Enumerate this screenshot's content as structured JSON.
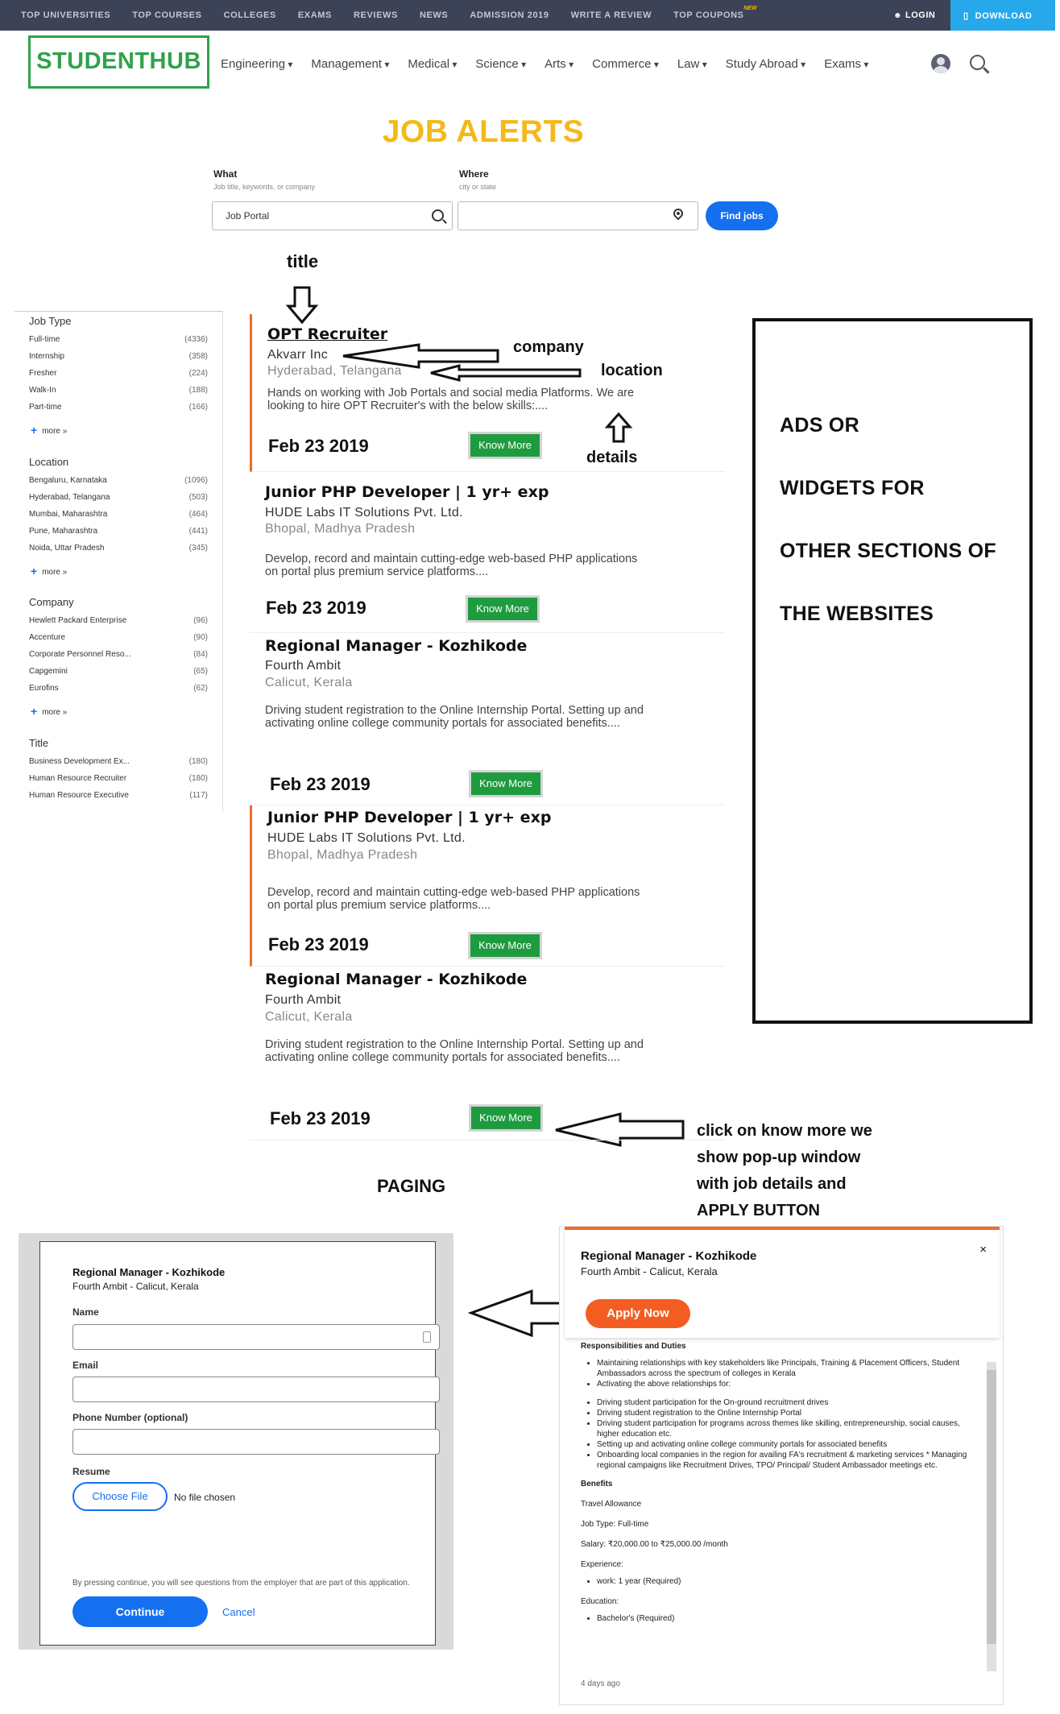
{
  "topbar": {
    "nav": [
      "TOP UNIVERSITIES",
      "TOP COURSES",
      "COLLEGES",
      "EXAMS",
      "REVIEWS",
      "NEWS",
      "ADMISSION 2019",
      "WRITE A REVIEW",
      "TOP COUPONS"
    ],
    "new_badge": "NEW",
    "login": "LOGIN",
    "download": "DOWNLOAD"
  },
  "header": {
    "logo": "STUDENTHUB",
    "nav": [
      "Engineering",
      "Management",
      "Medical",
      "Science",
      "Arts",
      "Commerce",
      "Law",
      "Study Abroad",
      "Exams"
    ]
  },
  "search": {
    "page_title": "JOB ALERTS",
    "what_label": "What",
    "what_sub": "Job title, keywords, or company",
    "what_value": "Job Portal",
    "where_label": "Where",
    "where_sub": "city or state",
    "where_value": "",
    "find_button": "Find jobs"
  },
  "annotations": {
    "title": "title",
    "company": "company",
    "location": "location",
    "details": "details",
    "paging": "PAGING",
    "popup_note": [
      "click on know more we",
      "show pop-up window",
      "with job details and",
      "APPLY BUTTON"
    ]
  },
  "sidebar": {
    "job_type": {
      "heading": "Job Type",
      "items": [
        {
          "label": "Full-time",
          "count": "(4336)"
        },
        {
          "label": "Internship",
          "count": "(358)"
        },
        {
          "label": "Fresher",
          "count": "(224)"
        },
        {
          "label": "Walk-In",
          "count": "(188)"
        },
        {
          "label": "Part-time",
          "count": "(166)"
        }
      ],
      "more": "more »"
    },
    "location": {
      "heading": "Location",
      "items": [
        {
          "label": "Bengaluru, Karnataka",
          "count": "(1096)"
        },
        {
          "label": "Hyderabad, Telangana",
          "count": "(503)"
        },
        {
          "label": "Mumbai, Maharashtra",
          "count": "(464)"
        },
        {
          "label": "Pune, Maharashtra",
          "count": "(441)"
        },
        {
          "label": "Noida, Uttar Pradesh",
          "count": "(345)"
        }
      ],
      "more": "more »"
    },
    "company": {
      "heading": "Company",
      "items": [
        {
          "label": "Hewlett Packard Enterprise",
          "count": "(96)"
        },
        {
          "label": "Accenture",
          "count": "(90)"
        },
        {
          "label": "Corporate Personnel Reso...",
          "count": "(84)"
        },
        {
          "label": "Capgemini",
          "count": "(65)"
        },
        {
          "label": "Eurofins",
          "count": "(62)"
        }
      ],
      "more": "more »"
    },
    "title": {
      "heading": "Title",
      "items": [
        {
          "label": "Business Development Ex...",
          "count": "(180)"
        },
        {
          "label": "Human Resource Recruiter",
          "count": "(180)"
        },
        {
          "label": "Human Resource Executive",
          "count": "(117)"
        }
      ]
    }
  },
  "jobs": [
    {
      "title": "OPT Recruiter",
      "company": "Akvarr Inc",
      "location": "Hyderabad, Telangana",
      "desc": "Hands on working with Job Portals and social media Platforms. We are looking to hire OPT Recruiter's with the below skills:....",
      "date": "Feb 23 2019",
      "button": "Know More"
    },
    {
      "title": "Junior PHP Developer | 1 yr+ exp",
      "company": "HUDE Labs IT Solutions Pvt. Ltd.",
      "location": "Bhopal, Madhya Pradesh",
      "desc": "Develop, record and maintain cutting-edge web-based PHP applications on portal plus premium service platforms....",
      "date": "Feb 23 2019",
      "button": "Know More"
    },
    {
      "title": "Regional Manager - Kozhikode",
      "company": "Fourth Ambit",
      "location": "Calicut, Kerala",
      "desc": "Driving student registration to the Online Internship Portal. Setting up and activating online college community portals for associated benefits....",
      "date": "Feb 23 2019",
      "button": "Know More"
    },
    {
      "title": "Junior PHP Developer | 1 yr+ exp",
      "company": "HUDE Labs IT Solutions Pvt. Ltd.",
      "location": "Bhopal, Madhya Pradesh",
      "desc": "Develop, record and maintain cutting-edge web-based PHP applications on portal plus premium service platforms....",
      "date": "Feb 23 2019",
      "button": "Know More"
    },
    {
      "title": "Regional Manager - Kozhikode",
      "company": "Fourth Ambit",
      "location": "Calicut, Kerala",
      "desc": "Driving student registration to the Online Internship Portal. Setting up and activating online college community portals for associated benefits....",
      "date": "Feb 23 2019",
      "button": "Know More"
    }
  ],
  "ads": [
    "ADS OR",
    "WIDGETS FOR",
    "OTHER SECTIONS OF",
    "THE WEBSITES"
  ],
  "apply_modal": {
    "title": "Regional Manager - Kozhikode",
    "subtitle": "Fourth Ambit - Calicut, Kerala",
    "name_label": "Name",
    "email_label": "Email",
    "phone_label": "Phone Number (optional)",
    "resume_label": "Resume",
    "choose_file": "Choose File",
    "no_file": "No file chosen",
    "note": "By pressing continue, you will see questions from the employer that are part of this application.",
    "continue": "Continue",
    "cancel": "Cancel"
  },
  "detail_modal": {
    "title": "Regional Manager - Kozhikode",
    "subtitle": "Fourth Ambit - Calicut, Kerala",
    "close": "×",
    "apply": "Apply Now",
    "resp_heading": "Responsibilities and Duties",
    "resp_list_1": [
      "Maintaining relationships with key stakeholders like Principals, Training & Placement Officers, Student Ambassadors across the spectrum of colleges in Kerala",
      "Activating the above relationships for:"
    ],
    "resp_list_2": [
      "Driving student participation for the On-ground recruitment drives",
      "Driving student registration to the Online Internship Portal",
      "Driving student participation for programs across themes like skilling, entrepreneurship, social causes, higher education etc.",
      "Setting up and activating online college community portals for associated benefits",
      "Onboarding local companies in the region for availing FA's recruitment & marketing services * Managing regional campaigns like Recruitment Drives, TPO/ Principal/ Student Ambassador meetings etc."
    ],
    "benefits_heading": "Benefits",
    "benefit": "Travel Allowance",
    "job_type": "Job Type: Full-time",
    "salary": "Salary: ₹20,000.00 to ₹25,000.00 /month",
    "experience_heading": "Experience:",
    "experience_list": [
      "work: 1 year (Required)"
    ],
    "education_heading": "Education:",
    "education_list": [
      "Bachelor's (Required)"
    ],
    "posted": "4 days ago"
  }
}
